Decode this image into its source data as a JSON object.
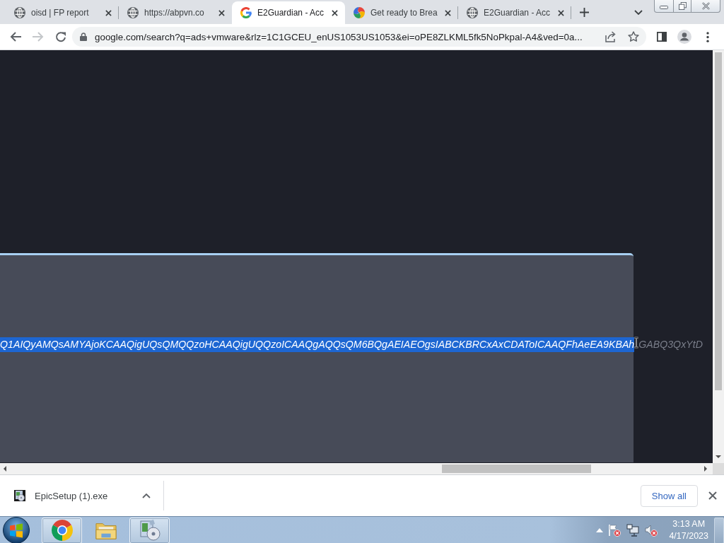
{
  "tabs": [
    {
      "kind": "globe",
      "title": "oisd | FP report",
      "selected": false
    },
    {
      "kind": "globe",
      "title": "https://abpvn.co",
      "selected": false
    },
    {
      "kind": "google",
      "title": "E2Guardian - Acc",
      "selected": true
    },
    {
      "kind": "swirl",
      "title": "Get ready to Brea",
      "selected": false
    },
    {
      "kind": "globe",
      "title": "E2Guardian - Acc",
      "selected": false
    }
  ],
  "toolbar": {
    "nav_buttons": [
      {
        "kind": "back",
        "disabled": false
      },
      {
        "kind": "forward",
        "disabled": true
      },
      {
        "kind": "reload",
        "disabled": false
      }
    ],
    "url": "google.com/search?q=ads+vmware&rlz=1C1GCEU_enUS1053US1053&ei=oPE8ZLKML5fk5NoPkpal-A4&ved=0a...",
    "bookmarked": false
  },
  "page": {
    "text_segments": [
      {
        "text": "Q1AIQyAMQsAMYAjoKCAAQigUQsQMQQzoHCAAQigUQQzoICAAQgAQQsQM6BQgAEIAEOgsIABCKBRCxAxCDAToICAAQFhAeEA9KBAh",
        "selected": true
      },
      {
        "text": "GABQ3QxYtD",
        "selected": false
      }
    ]
  },
  "download_shelf": {
    "items": [
      {
        "filename": "EpicSetup (1).exe"
      }
    ],
    "show_all": "Show all"
  },
  "taskbar": {
    "apps": [
      {
        "kind": "browser",
        "running": true
      },
      {
        "kind": "folder",
        "running": false
      },
      {
        "kind": "installer",
        "running": true
      }
    ],
    "clock": {
      "time": "3:13 AM",
      "date": "4/17/2023"
    }
  }
}
